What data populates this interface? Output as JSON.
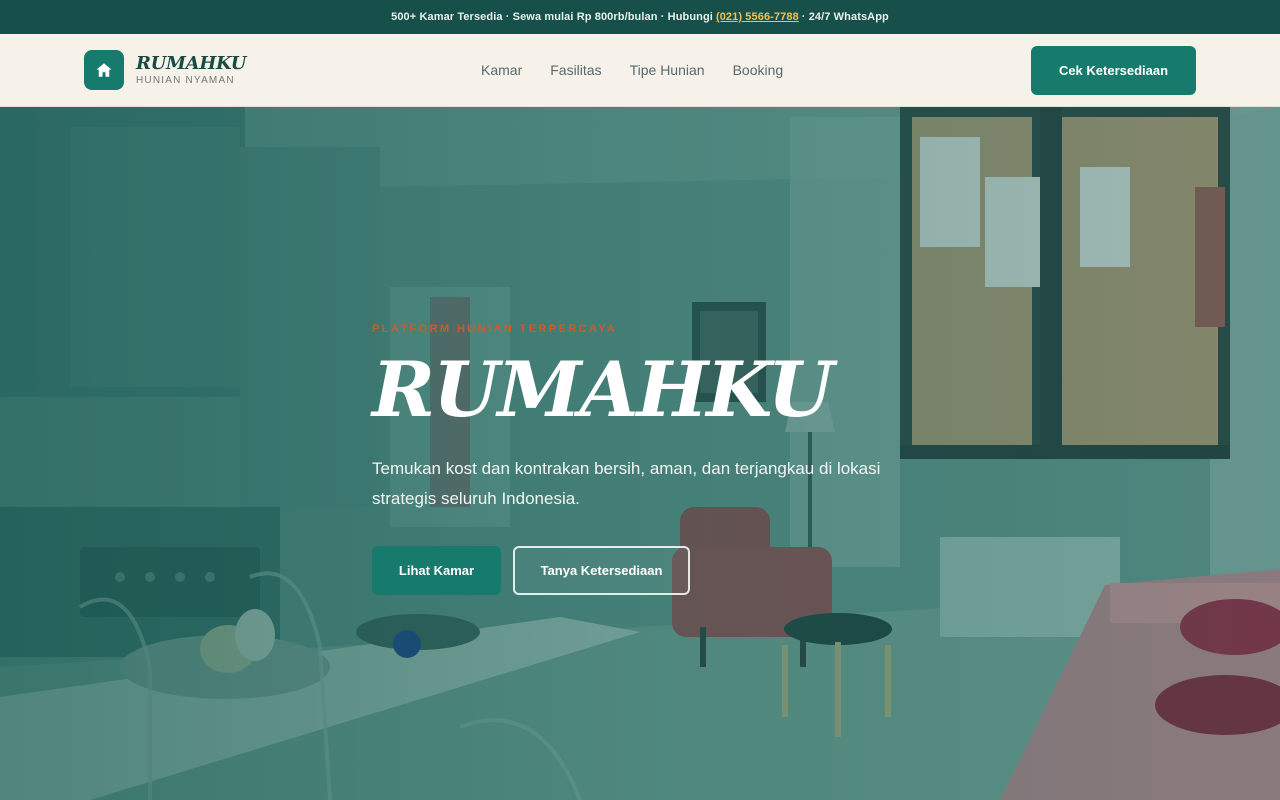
{
  "topbar": {
    "text_before": "500+ Kamar Tersedia · Sewa mulai Rp 800rb/bulan · Hubungi",
    "phone": "(021) 5566-7788",
    "text_after": "· 24/7 WhatsApp"
  },
  "brand": {
    "name": "RUMAHKU",
    "tagline": "HUNIAN NYAMAN",
    "icon": "home-icon"
  },
  "nav": {
    "links": [
      "Kamar",
      "Fasilitas",
      "Tipe Hunian",
      "Booking"
    ],
    "cta": "Cek Ketersediaan"
  },
  "hero": {
    "eyebrow": "PLATFORM HUNIAN TERPERCAYA",
    "title": "RUMAHKU",
    "description": "Temukan kost dan kontrakan bersih, aman, dan terjangkau di lokasi strategis seluruh Indonesia.",
    "primary_button": "Lihat Kamar",
    "secondary_button": "Tanya Ketersediaan"
  },
  "colors": {
    "primary": "#167a6c",
    "topbar": "#17504a",
    "accent": "#d45a22",
    "phone_link": "#f2c14e",
    "navbar_bg": "#f6f1e9"
  }
}
